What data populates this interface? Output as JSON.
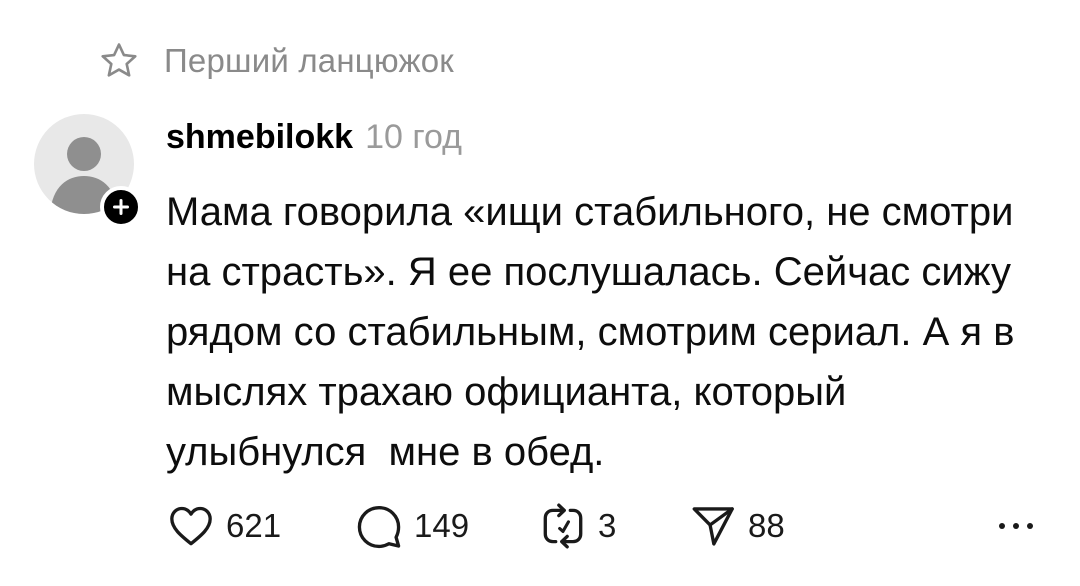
{
  "thread": {
    "title": "Перший ланцюжок",
    "star_icon": "star-icon"
  },
  "post": {
    "author": {
      "username": "shmebilokk",
      "avatar_icon": "default-avatar-icon",
      "follow_icon": "plus-icon"
    },
    "timestamp": "10 год",
    "text_lines": [
      "Мама говорила «ищи стабильного, не смотри",
      "на страсть». Я ее послушалась. Сейчас сижу",
      "рядом со стабильным, смотрим сериал. А я в",
      "мыслях трахаю официанта, который",
      "улыбнулся  мне в обед."
    ],
    "stats": {
      "likes": "621",
      "replies": "149",
      "reposts": "3",
      "shares": "88"
    }
  },
  "colors": {
    "text": "#0d0d0d",
    "muted": "#8a8a8a",
    "avatar_bg": "#e8e8e8",
    "avatar_fg": "#8f8f8f"
  }
}
